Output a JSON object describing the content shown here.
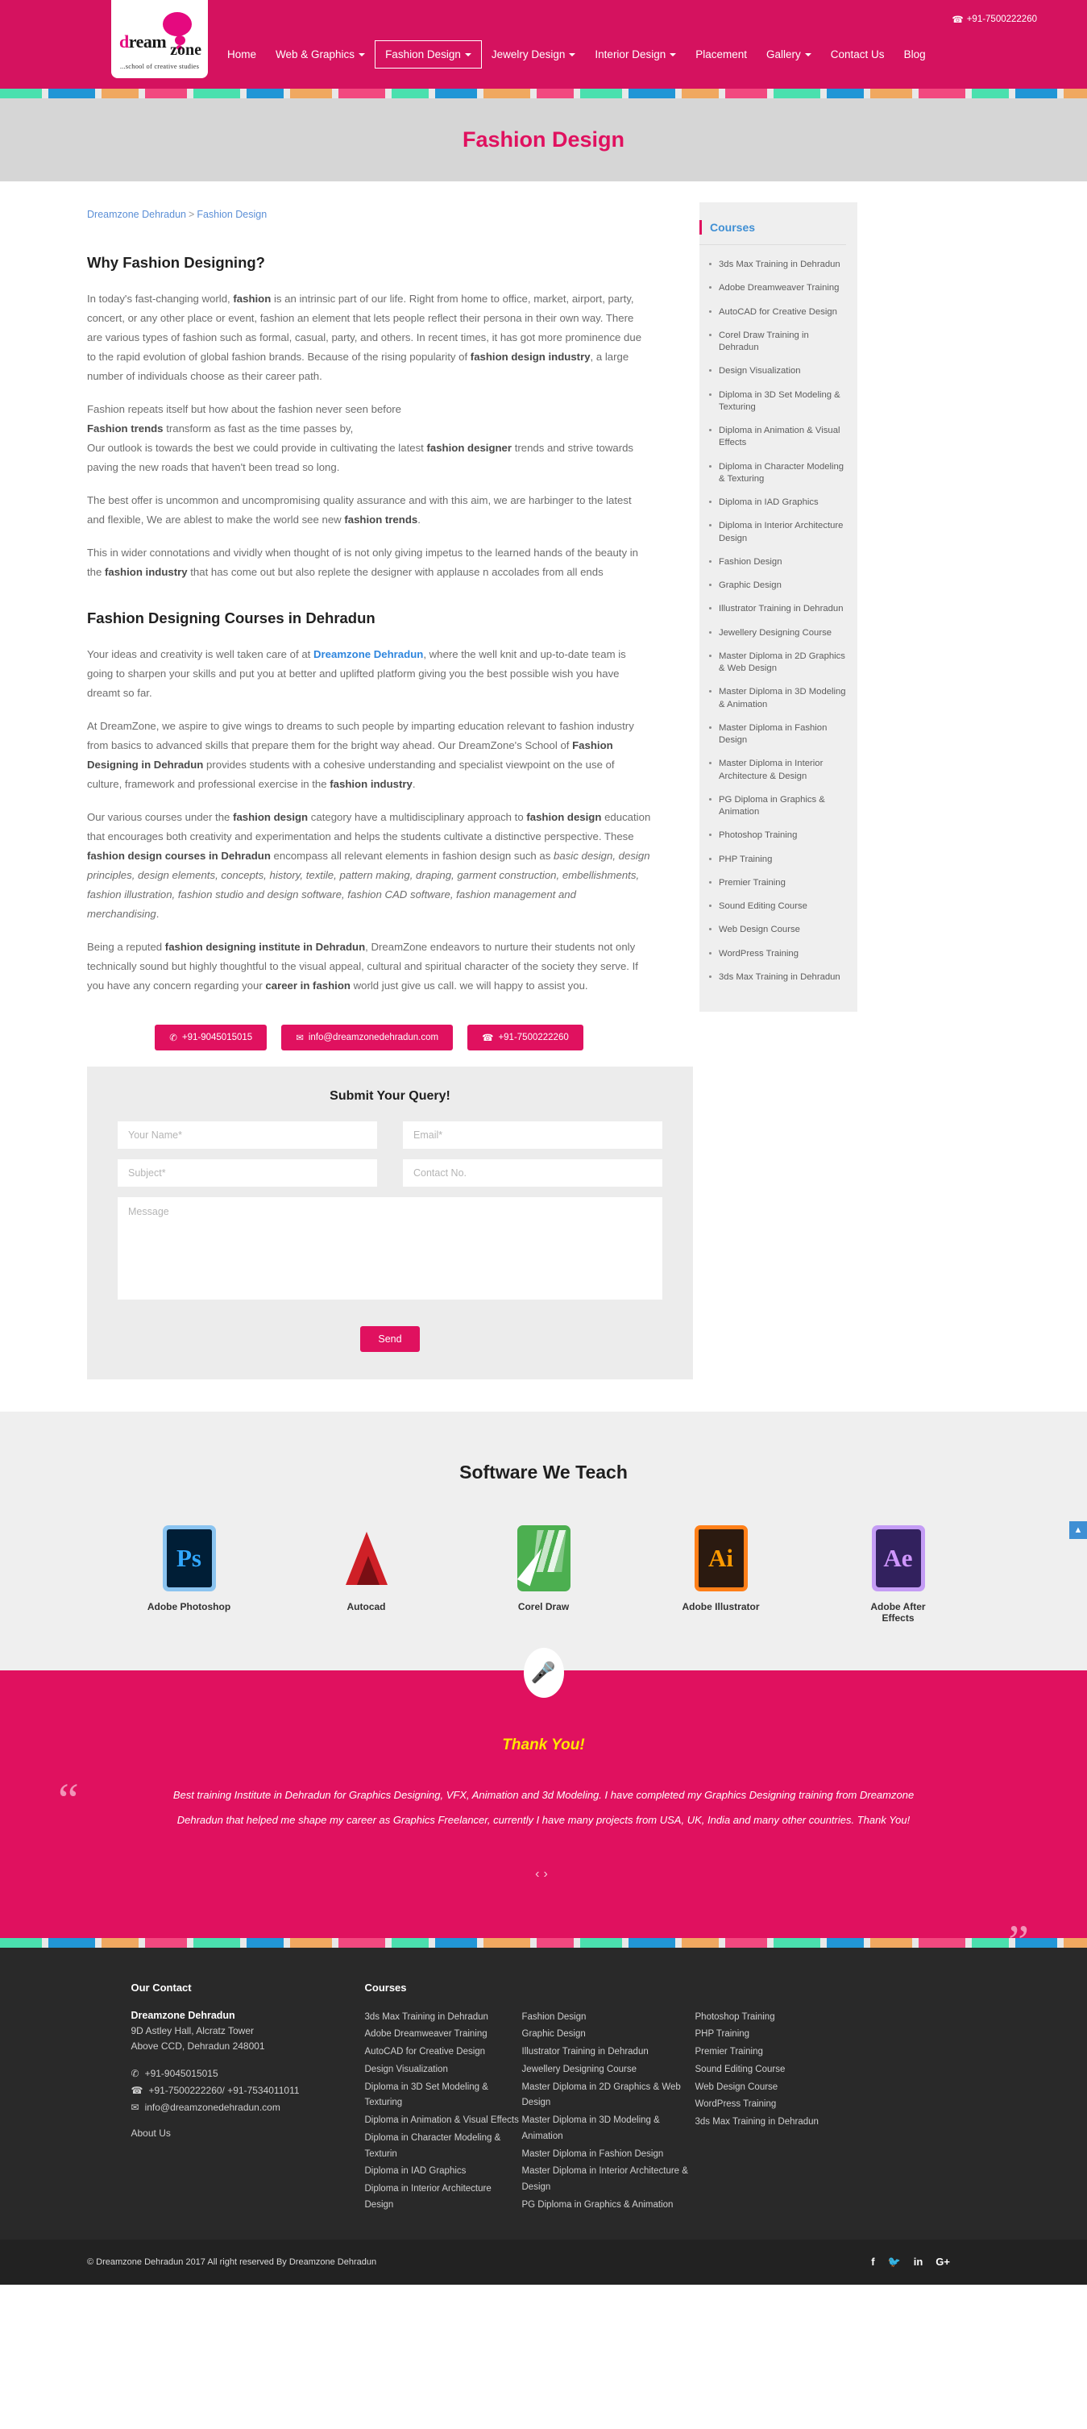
{
  "header": {
    "phone": "+91-7500222260",
    "phone_icon": "phone-icon",
    "logo": {
      "word1": "d",
      "word1b": "ream",
      "word2": "zone",
      "tagline": "...school of creative studies"
    },
    "nav": [
      {
        "label": "Home",
        "caret": false
      },
      {
        "label": "Web & Graphics",
        "caret": true
      },
      {
        "label": "Fashion Design",
        "caret": true,
        "active": true
      },
      {
        "label": "Jewelry Design",
        "caret": true
      },
      {
        "label": "Interior Design",
        "caret": true
      },
      {
        "label": "Placement",
        "caret": false
      },
      {
        "label": "Gallery",
        "caret": true
      },
      {
        "label": "Contact Us",
        "caret": false
      },
      {
        "label": "Blog",
        "caret": false
      }
    ]
  },
  "banner": {
    "title": "Fashion Design"
  },
  "breadcrumb": {
    "home": "Dreamzone Dehradun",
    "sep": ">",
    "current": "Fashion Design"
  },
  "article": {
    "h1": "Why Fashion Designing?",
    "p1_a": "In today's fast-changing world, ",
    "p1_b": "fashion",
    "p1_c": " is an intrinsic part of our life. Right from home to office, market, airport, party, concert, or any other place or event, fashion an element that lets people reflect their persona in their own way. There are various types of fashion such as formal, casual, party, and others. In recent times, it has got more prominence due to the rapid evolution of global fashion brands. Because of the rising popularity of ",
    "p1_d": "fashion design industry",
    "p1_e": ", a large number of individuals choose as their career path.",
    "p2_l1": "Fashion repeats itself but how about the fashion never seen before",
    "p2_l2_b": "Fashion trends",
    "p2_l2_r": " transform as fast as the time passes by,",
    "p2_l3_a": "Our outlook is towards the best we could provide in cultivating the latest ",
    "p2_l3_b": "fashion designer",
    "p2_l3_c": " trends and strive towards paving the new roads that haven't been tread so long.",
    "p3_a": "The best offer is uncommon and uncompromising quality assurance and with this aim, we are harbinger to the latest and flexible, We are ablest to make the world see new ",
    "p3_b": "fashion trends",
    "p3_c": ".",
    "p4_a": "This in wider connotations and vividly when thought of is not only giving impetus to the learned hands of the beauty in the ",
    "p4_b": "fashion industry",
    "p4_c": " that has come out but also replete the designer with applause n accolades from all ends",
    "h2": "Fashion Designing Courses in Dehradun",
    "p5_a": "Your ideas and creativity is well taken care of at ",
    "p5_link": "Dreamzone Dehradun",
    "p5_b": ", where the well knit and up-to-date team is going to sharpen your skills and put you at better and uplifted platform giving you the best possible wish you have dreamt so far.",
    "p6_a": "At DreamZone, we aspire to give wings to dreams to such people by imparting education relevant to fashion industry from basics to advanced skills that prepare them for the bright way ahead. Our DreamZone's School of ",
    "p6_b": "Fashion Designing in Dehradun",
    "p6_c": " provides students with a cohesive understanding and specialist viewpoint on the use of culture, framework and professional exercise in the ",
    "p6_d": "fashion industry",
    "p6_e": ".",
    "p7_a": "Our various courses under the ",
    "p7_b": "fashion design",
    "p7_c": " category have a multidisciplinary approach to ",
    "p7_d": "fashion design",
    "p7_e": " education that encourages both creativity and experimentation and helps the students cultivate a distinctive perspective. These ",
    "p7_f": "fashion design courses in Dehradun",
    "p7_g": " encompass all relevant elements in fashion design such as ",
    "p7_i": "basic design, design principles, design elements, concepts, history, textile, pattern making, draping, garment construction, embellishments, fashion illustration, fashion studio and design software, fashion CAD software, fashion management and merchandising",
    "p7_h": ".",
    "p8_a": "Being a reputed ",
    "p8_b": "fashion designing institute in Dehradun",
    "p8_c": ", DreamZone endeavors to nurture their students not only technically sound but highly thoughtful to the visual appeal, cultural and spiritual character of the society they serve.  If you have any concern regarding your ",
    "p8_d": "career in fashion",
    "p8_e": " world just give us call. we will happy to assist you."
  },
  "cta": [
    {
      "icon": "whatsapp-icon",
      "label": "+91-9045015015"
    },
    {
      "icon": "mail-icon",
      "label": "info@dreamzonedehradun.com"
    },
    {
      "icon": "phone-icon",
      "label": "+91-7500222260"
    }
  ],
  "sidebar": {
    "title": "Courses",
    "items": [
      "3ds Max Training in Dehradun",
      "Adobe Dreamweaver Training",
      "AutoCAD for Creative Design",
      "Corel Draw Training in Dehradun",
      "Design Visualization",
      "Diploma in 3D Set Modeling & Texturing",
      "Diploma in Animation & Visual Effects",
      "Diploma in Character Modeling & Texturing",
      "Diploma in IAD Graphics",
      "Diploma in Interior Architecture Design",
      "Fashion Design",
      "Graphic Design",
      "Illustrator Training in Dehradun",
      "Jewellery Designing Course",
      "Master Diploma in 2D Graphics & Web Design",
      "Master Diploma in 3D Modeling & Animation",
      "Master Diploma in Fashion Design",
      "Master Diploma in Interior Architecture & Design",
      "PG Diploma in Graphics & Animation",
      "Photoshop Training",
      "PHP Training",
      "Premier Training",
      "Sound Editing Course",
      "Web Design Course",
      "WordPress Training",
      "3ds Max Training in Dehradun"
    ]
  },
  "form": {
    "title": "Submit Your Query!",
    "name_placeholder": "Your Name*",
    "email_placeholder": "Email*",
    "subject_placeholder": "Subject*",
    "contact_placeholder": "Contact No.",
    "message_placeholder": "Message",
    "send_label": "Send"
  },
  "scrolltop": {
    "glyph": "▲"
  },
  "software": {
    "title": "Software We Teach",
    "items": [
      {
        "label": "Adobe Photoshop",
        "mark": "Ps",
        "icon": "photoshop-icon"
      },
      {
        "label": "Autocad",
        "mark": "",
        "icon": "autocad-icon"
      },
      {
        "label": "Corel Draw",
        "mark": "",
        "icon": "coreldraw-icon"
      },
      {
        "label": "Adobe Illustrator",
        "mark": "Ai",
        "icon": "illustrator-icon"
      },
      {
        "label": "Adobe After Effects",
        "mark": "Ae",
        "icon": "aftereffects-icon"
      }
    ]
  },
  "testimonial": {
    "mic_icon": "microphone-icon",
    "heading": "Thank You!",
    "body": "Best training Institute in Dehradun for Graphics Designing, VFX, Animation and 3d Modeling. I have completed my Graphics Designing training from Dreamzone Dehradun that helped me shape my career as Graphics Freelancer, currently I have many projects from USA, UK, India and many other countries. Thank You!",
    "prev": "‹",
    "next": "›",
    "quote_open": "“",
    "quote_close": "”"
  },
  "footer": {
    "contact_title": "Our Contact",
    "org": "Dreamzone Dehradun",
    "addr1": "9D Astley Hall, Alcratz Tower",
    "addr2": "Above CCD, Dehradun 248001",
    "whatsapp": "+91-9045015015",
    "phones": "+91-7500222260/ +91-7534011011",
    "email": "info@dreamzonedehradun.com",
    "about": "About Us",
    "courses_title": "Courses",
    "col1": [
      "3ds Max Training in Dehradun",
      "Adobe Dreamweaver Training",
      "AutoCAD for Creative Design",
      "Design Visualization",
      "Diploma in 3D Set Modeling & Texturing",
      "Diploma in Animation & Visual Effects",
      "Diploma in Character Modeling & Texturin",
      "Diploma in IAD Graphics",
      "Diploma in Interior Architecture Design"
    ],
    "col2": [
      "Fashion Design",
      "Graphic Design",
      "Illustrator Training in Dehradun",
      "Jewellery Designing Course",
      "Master Diploma in 2D Graphics & Web Design",
      "Master Diploma in 3D Modeling & Animation",
      "Master Diploma in Fashion Design",
      "Master Diploma in Interior Architecture & Design",
      "PG Diploma in Graphics & Animation"
    ],
    "col3": [
      "Photoshop Training",
      "PHP Training",
      "Premier Training",
      "Sound Editing Course",
      "Web Design Course",
      "WordPress Training",
      "3ds Max Training in Dehradun"
    ],
    "copyright": "© Dreamzone Dehradun 2017 All right reserved By Dreamzone Dehradun",
    "socials": [
      {
        "name": "facebook-icon",
        "glyph": "f"
      },
      {
        "name": "twitter-icon",
        "glyph": "🐦"
      },
      {
        "name": "linkedin-icon",
        "glyph": "in"
      },
      {
        "name": "googleplus-icon",
        "glyph": "G+"
      }
    ]
  },
  "colors": {
    "brand_pink": "#e0115f",
    "header_pink": "#d5125f",
    "link_blue": "#3f8fd4",
    "strip": [
      "#4ae0ae",
      "#2196d6",
      "#f0a860",
      "#f2497f",
      "#4ae0ae",
      "#2196d6",
      "#f0a860",
      "#f2497f"
    ]
  }
}
